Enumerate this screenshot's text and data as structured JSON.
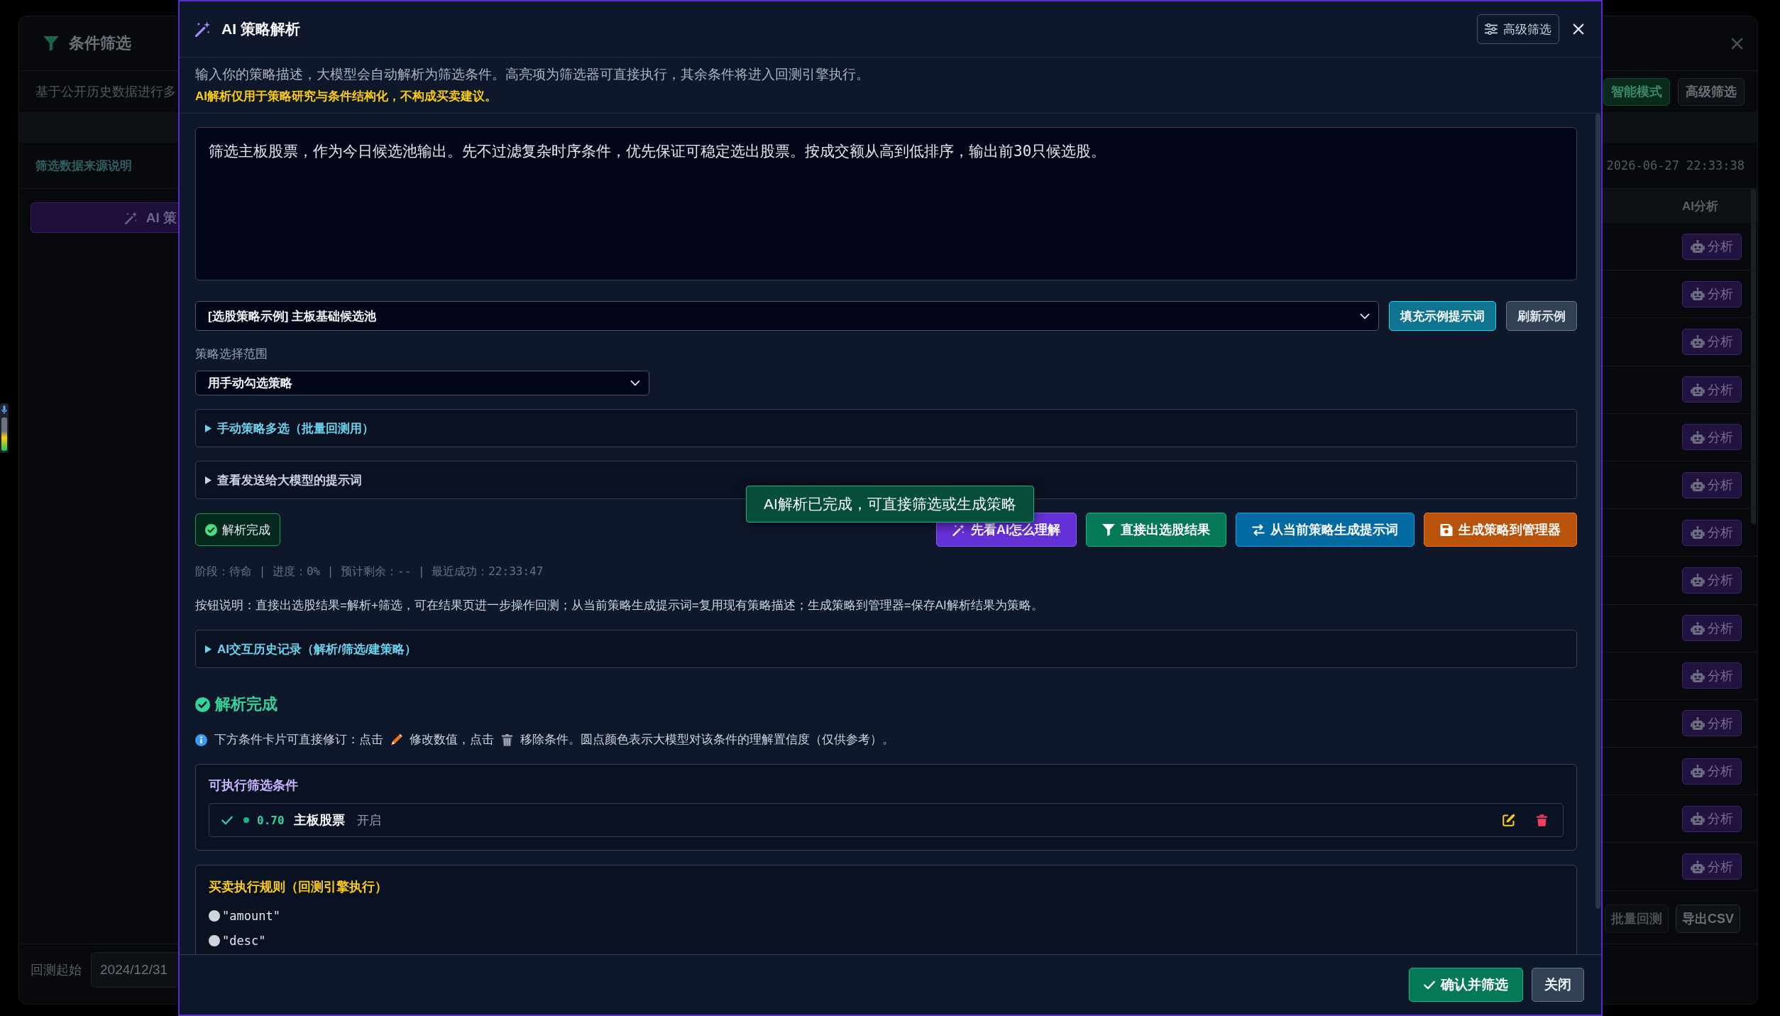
{
  "background_app": {
    "title": "条件筛选",
    "subtitle": "基于公开历史数据进行多",
    "mode_buttons": [
      {
        "label": "智能模式",
        "selected": true
      },
      {
        "label": "高级筛选",
        "selected": false
      }
    ],
    "source_link": "筛选数据来源说明",
    "timestamp": "2026-06-27 22:33:38",
    "ai_button": "AI 策",
    "table": {
      "columns": [
        "AI分析"
      ],
      "rows": [
        {
          "ai_action": "分析"
        },
        {
          "ai_action": "分析"
        },
        {
          "ai_action": "分析"
        },
        {
          "ai_action": "分析"
        },
        {
          "ai_action": "分析"
        },
        {
          "ai_action": "分析"
        },
        {
          "ai_action": "分析"
        },
        {
          "ai_action": "分析"
        },
        {
          "ai_action": "分析"
        },
        {
          "ai_action": "分析"
        },
        {
          "ai_action": "分析"
        },
        {
          "ai_action": "分析"
        },
        {
          "ai_action": "分析"
        },
        {
          "ai_action": "分析"
        }
      ]
    },
    "actions": [
      {
        "label": "批量回测",
        "disabled": true
      },
      {
        "label": "导出CSV",
        "disabled": false
      }
    ],
    "backtest_start": {
      "label": "回测起始",
      "value": "2024/12/31"
    }
  },
  "dialog": {
    "title": "AI 策略解析",
    "advanced_button": "高级筛选",
    "description": "输入你的策略描述，大模型会自动解析为筛选条件。高亮项为筛选器可直接执行，其余条件将进入回测引擎执行。",
    "disclaimer": "AI解析仅用于策略研究与条件结构化，不构成买卖建议。",
    "prompt": {
      "value": "筛选主板股票，作为今日候选池输出。先不过滤复杂时序条件，优先保证可稳定选出股票。按成交额从高到低排序，输出前30只候选股。"
    },
    "example_select": {
      "value": "[选股策略示例] 主板基础候选池"
    },
    "example_buttons": [
      {
        "label": "填充示例提示词",
        "kind": "fill"
      },
      {
        "label": "刷新示例",
        "kind": "refresh"
      }
    ],
    "scope": {
      "label": "策略选择范围",
      "value": "用手动勾选策略"
    },
    "panels": [
      {
        "label": "手动策略多选（批量回测用）",
        "expanded": false,
        "kind": "accent"
      },
      {
        "label": "查看发送给大模型的提示词",
        "expanded": false,
        "kind": "plain"
      }
    ],
    "status_badge": "解析完成",
    "actions": [
      {
        "label": "先看AI怎么理解",
        "kind": "understand"
      },
      {
        "label": "直接出选股结果",
        "kind": "screen"
      },
      {
        "label": "从当前策略生成提示词",
        "kind": "prompt"
      },
      {
        "label": "生成策略到管理器",
        "kind": "save"
      }
    ],
    "toast": "AI解析已完成，可直接筛选或生成策略",
    "progress_line": "阶段：待命 | 进度：0% | 预计剩余：-- | 最近成功：22:33:47",
    "button_help": "按钮说明：直接出选股结果=解析+筛选，可在结果页进一步操作回测；从当前策略生成提示词=复用现有策略描述；生成策略到管理器=保存AI解析结果为策略。",
    "history_panel": {
      "label": "AI交互历史记录（解析/筛选/建策略）",
      "expanded": false,
      "kind": "accent"
    },
    "result": {
      "heading": "解析完成",
      "hint": [
        "下方条件卡片可直接修订：点击",
        "修改数值，点击",
        "移除条件。圆点颜色表示大模型对该条件的理解置信度（仅供参考）。"
      ],
      "conditions": {
        "title": "可执行筛选条件",
        "items": [
          {
            "checked": true,
            "color": "#10b981",
            "confidence": "0.70",
            "name": "主板股票",
            "value": "开启"
          }
        ]
      },
      "rules": {
        "title": "买卖执行规则（回测引擎执行）",
        "items": [
          {
            "text": "\"amount\""
          },
          {
            "text": "\"desc\""
          }
        ]
      }
    },
    "footer_buttons": [
      {
        "label": "确认并筛选",
        "kind": "confirm"
      },
      {
        "label": "关闭",
        "kind": "close"
      }
    ]
  }
}
